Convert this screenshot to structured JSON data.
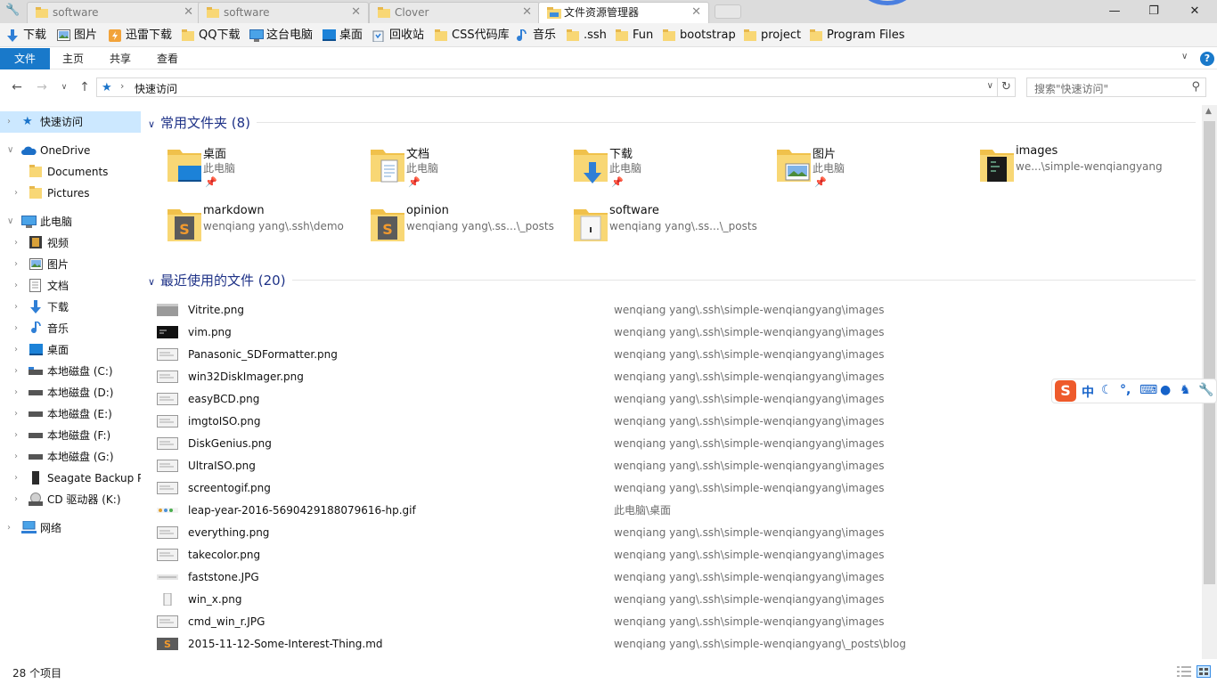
{
  "tabs": [
    {
      "title": "software"
    },
    {
      "title": "software"
    },
    {
      "title": "Clover"
    },
    {
      "title": "文件资源管理器"
    }
  ],
  "window_controls": {
    "minimize": "—",
    "restore": "❐",
    "close": "✕"
  },
  "bookmarks": [
    {
      "label": "下载",
      "icon": "download-arrow-icon"
    },
    {
      "label": "图片",
      "icon": "pictures-icon"
    },
    {
      "label": "迅雷下载",
      "icon": "thunder-icon"
    },
    {
      "label": "QQ下载",
      "icon": "folder-icon"
    },
    {
      "label": "这台电脑",
      "icon": "computer-icon"
    },
    {
      "label": "桌面",
      "icon": "desktop-icon"
    },
    {
      "label": "回收站",
      "icon": "recycle-bin-icon"
    },
    {
      "label": "CSS代码库",
      "icon": "folder-icon"
    },
    {
      "label": "音乐",
      "icon": "music-icon"
    },
    {
      "label": ".ssh",
      "icon": "folder-icon"
    },
    {
      "label": "Fun",
      "icon": "folder-icon"
    },
    {
      "label": "bootstrap",
      "icon": "folder-icon"
    },
    {
      "label": "project",
      "icon": "folder-icon"
    },
    {
      "label": "Program Files",
      "icon": "folder-icon"
    }
  ],
  "ribbon": {
    "file": "文件",
    "home": "主页",
    "share": "共享",
    "view": "查看",
    "help": "?"
  },
  "address": {
    "path": "快速访问",
    "search_placeholder": "搜索\"快速访问\""
  },
  "nav_pane": [
    {
      "label": "快速访问",
      "icon": "star-icon"
    },
    {
      "label": "OneDrive",
      "icon": "cloud-icon"
    },
    {
      "label": "Documents",
      "icon": "folder-icon"
    },
    {
      "label": "Pictures",
      "icon": "folder-icon"
    },
    {
      "label": "此电脑",
      "icon": "computer-icon"
    },
    {
      "label": "视频",
      "icon": "video-icon"
    },
    {
      "label": "图片",
      "icon": "pictures-icon"
    },
    {
      "label": "文档",
      "icon": "document-icon"
    },
    {
      "label": "下载",
      "icon": "download-arrow-icon"
    },
    {
      "label": "音乐",
      "icon": "music-icon"
    },
    {
      "label": "桌面",
      "icon": "desktop-icon"
    },
    {
      "label": "本地磁盘 (C:)",
      "icon": "drive-icon"
    },
    {
      "label": "本地磁盘 (D:)",
      "icon": "drive-icon"
    },
    {
      "label": "本地磁盘 (E:)",
      "icon": "drive-icon"
    },
    {
      "label": "本地磁盘 (F:)",
      "icon": "drive-icon"
    },
    {
      "label": "本地磁盘 (G:)",
      "icon": "drive-icon"
    },
    {
      "label": "Seagate Backup P",
      "icon": "external-drive-icon"
    },
    {
      "label": "CD 驱动器 (K:)",
      "icon": "cd-drive-icon"
    },
    {
      "label": "网络",
      "icon": "network-icon"
    }
  ],
  "frequent": {
    "title": "常用文件夹 (8)",
    "items": [
      {
        "name": "桌面",
        "sub": "此电脑",
        "icon": "desktop-folder-icon"
      },
      {
        "name": "文档",
        "sub": "此电脑",
        "icon": "documents-folder-icon"
      },
      {
        "name": "下载",
        "sub": "此电脑",
        "icon": "downloads-folder-icon"
      },
      {
        "name": "图片",
        "sub": "此电脑",
        "icon": "pictures-folder-icon"
      },
      {
        "name": "images",
        "sub": "we...\\simple-wenqiangyang",
        "icon": "images-folder-icon"
      },
      {
        "name": "markdown",
        "sub": "wenqiang yang\\.ssh\\demo",
        "icon": "markdown-folder-icon"
      },
      {
        "name": "opinion",
        "sub": "wenqiang yang\\.ss...\\_posts",
        "icon": "opinion-folder-icon"
      },
      {
        "name": "software",
        "sub": "wenqiang yang\\.ss...\\_posts",
        "icon": "software-folder-icon"
      }
    ],
    "pin": "📌"
  },
  "recent": {
    "title": "最近使用的文件 (20)",
    "files": [
      {
        "name": "Vitrite.png",
        "path": "wenqiang yang\\.ssh\\simple-wenqiangyang\\images"
      },
      {
        "name": "vim.png",
        "path": "wenqiang yang\\.ssh\\simple-wenqiangyang\\images"
      },
      {
        "name": "Panasonic_SDFormatter.png",
        "path": "wenqiang yang\\.ssh\\simple-wenqiangyang\\images"
      },
      {
        "name": "win32DiskImager.png",
        "path": "wenqiang yang\\.ssh\\simple-wenqiangyang\\images"
      },
      {
        "name": "easyBCD.png",
        "path": "wenqiang yang\\.ssh\\simple-wenqiangyang\\images"
      },
      {
        "name": "imgtoISO.png",
        "path": "wenqiang yang\\.ssh\\simple-wenqiangyang\\images"
      },
      {
        "name": "DiskGenius.png",
        "path": "wenqiang yang\\.ssh\\simple-wenqiangyang\\images"
      },
      {
        "name": "UltraISO.png",
        "path": "wenqiang yang\\.ssh\\simple-wenqiangyang\\images"
      },
      {
        "name": "screentogif.png",
        "path": "wenqiang yang\\.ssh\\simple-wenqiangyang\\images"
      },
      {
        "name": "leap-year-2016-5690429188079616-hp.gif",
        "path": "此电脑\\桌面"
      },
      {
        "name": "everything.png",
        "path": "wenqiang yang\\.ssh\\simple-wenqiangyang\\images"
      },
      {
        "name": "takecolor.png",
        "path": "wenqiang yang\\.ssh\\simple-wenqiangyang\\images"
      },
      {
        "name": "faststone.JPG",
        "path": "wenqiang yang\\.ssh\\simple-wenqiangyang\\images"
      },
      {
        "name": "win_x.png",
        "path": "wenqiang yang\\.ssh\\simple-wenqiangyang\\images"
      },
      {
        "name": "cmd_win_r.JPG",
        "path": "wenqiang yang\\.ssh\\simple-wenqiangyang\\images"
      },
      {
        "name": "2015-11-12-Some-Interest-Thing.md",
        "path": "wenqiang yang\\.ssh\\simple-wenqiangyang\\_posts\\blog"
      }
    ]
  },
  "status": {
    "count": "28 个项目"
  },
  "ime": {
    "logo": "S",
    "mode": "中"
  },
  "colors": {
    "accent": "#1979ca",
    "group_heading": "#1e3287",
    "selected": "#cce8ff",
    "folder": "#f8d775"
  }
}
